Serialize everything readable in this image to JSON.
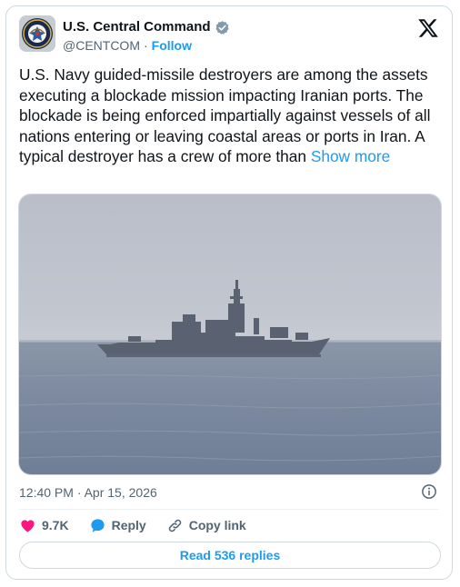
{
  "author": {
    "display_name": "U.S. Central Command",
    "handle": "@CENTCOM",
    "separator": "·",
    "follow_label": "Follow",
    "verified": true
  },
  "tweet": {
    "text": "U.S. Navy guided-missile destroyers are among the assets executing a blockade mission impacting Iranian ports. The blockade is being enforced impartially against vessels of all nations entering or leaving coastal areas or ports in Iran. A typical destroyer has a crew of more than ",
    "show_more": "Show more",
    "timestamp": "12:40 PM · Apr 15, 2026"
  },
  "media": {
    "subject": "Navy destroyer at sea under hazy sky"
  },
  "actions": {
    "like_count": "9.7K",
    "reply_label": "Reply",
    "copy_link_label": "Copy link"
  },
  "read_replies_label": "Read 536 replies",
  "colors": {
    "accent": "#1d9bf0",
    "like": "#f91880",
    "text": "#0f1419",
    "secondary": "#536471",
    "border": "#cfd9de"
  },
  "icons": {
    "platform": "x-logo-icon",
    "verified": "verified-badge-icon",
    "info": "info-icon",
    "like": "heart-icon",
    "reply": "reply-bubble-icon",
    "copy_link": "link-icon"
  }
}
